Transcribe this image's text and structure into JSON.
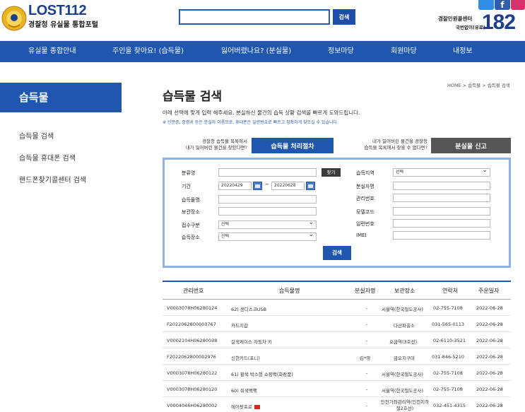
{
  "header": {
    "logo_title": "LOST112",
    "logo_subtitle": "경찰청 유실물 통합포털",
    "search_value": "",
    "search_button": "검색",
    "call_center_title": "경찰민원콜센터",
    "call_center_sub": "국번없이(유료)",
    "call_center_number": "182",
    "facebook_glyph": "f"
  },
  "nav": {
    "items": [
      "유실물 종합안내",
      "주인을 찾아요! (습득물)",
      "잃어버렸나요? (분실물)",
      "정보마당",
      "회원마당",
      "내정보"
    ]
  },
  "sidebar": {
    "title": "습득물",
    "items": [
      "습득물 검색",
      "습득물 휴대폰 검색",
      "핸드폰찾기콜센터 검색"
    ]
  },
  "main": {
    "breadcrumb": "HOME > 습득물 > 습득물 검색",
    "title": "습득물 검색",
    "description": "아래 선택에 맞게 입력 해주세요. 분실하신 물건의 습득 상황 검색을 빠르게 도와드립니다.",
    "note": "※ 신분증, 증명서 등은 분실자 이름으로, 휴대폰은 일련번호로 빠르고 정확하게 찾으실 수 있습니다.",
    "info_left_line1": "경찰청 습득물 목록에서",
    "info_left_line2": "내가 잃어버린 물건을 찾았다면?",
    "process_button": "습득물 처리절차",
    "info_right_line1": "내가 잃어버린 물건을 경찰청",
    "info_right_line2": "습득물 목록에서 찾을 수 없다면?",
    "report_button": "분실물 신고"
  },
  "form": {
    "labels": {
      "category": "분류명",
      "period": "기간",
      "item_name": "습득물명",
      "storage": "보관장소",
      "receipt_type": "접수구분",
      "found_place": "습득장소",
      "found_region": "습득지역",
      "loser_name": "분실자명",
      "manage_no": "관리번호",
      "model_code": "모델코드",
      "serial_no": "일련번호",
      "imei": "IMEI"
    },
    "find_button": "찾기",
    "date_from": "20220429",
    "date_to": "20220628",
    "date_sep": "~",
    "receipt_select": "선택",
    "place_select": "선택",
    "region_select": "선택",
    "search_button": "검색"
  },
  "table": {
    "headers": [
      "관리번호",
      "습득물명",
      "분실자명",
      "보관장소",
      "연락처",
      "주운일자"
    ],
    "rows": [
      {
        "id": "V0003078H06280124",
        "name": "62) 샌디스크USB",
        "owner": "-",
        "place": "서울역(한국철도공사)",
        "phone": "02-755-7108",
        "date": "2022-06-28"
      },
      {
        "id": "F2022062800003767",
        "name": "카드지갑",
        "owner": "-",
        "place": "다산파출소",
        "phone": "031-565-0113",
        "date": "2022-06-28"
      },
      {
        "id": "V0002104H06280038",
        "name": "갈색케이스 자동차 키",
        "owner": "-",
        "place": "오금역(3호선)",
        "phone": "02-6110-3521",
        "date": "2022-06-28"
      },
      {
        "id": "F2022062800002976",
        "name": "신한카드(포니)",
        "owner": "김*영",
        "place": "금오지구대",
        "phone": "031-846-5210",
        "date": "2022-06-28"
      },
      {
        "id": "V0003078H06280122",
        "name": "61) 황색 박스형 쇼핑백(화장품)",
        "owner": "-",
        "place": "서울역(한국철도공사)",
        "phone": "02-755-7108",
        "date": "2022-06-28"
      },
      {
        "id": "V0003078H06280120",
        "name": "60) 쥐색백팩",
        "owner": "-",
        "place": "서울역(한국철도공사)",
        "phone": "02-755-7108",
        "date": "2022-06-28"
      },
      {
        "id": "V0004046H06280002",
        "name": "에어팟프로",
        "owner": "-",
        "place": "인천가좌관리역(인천지하철2호선)",
        "phone": "032-451-4315",
        "date": "2022-06-28"
      }
    ]
  },
  "colors": {
    "brand_blue": "#1e56b0",
    "form_border": "#8fb2e2",
    "dark_button": "#555555"
  }
}
